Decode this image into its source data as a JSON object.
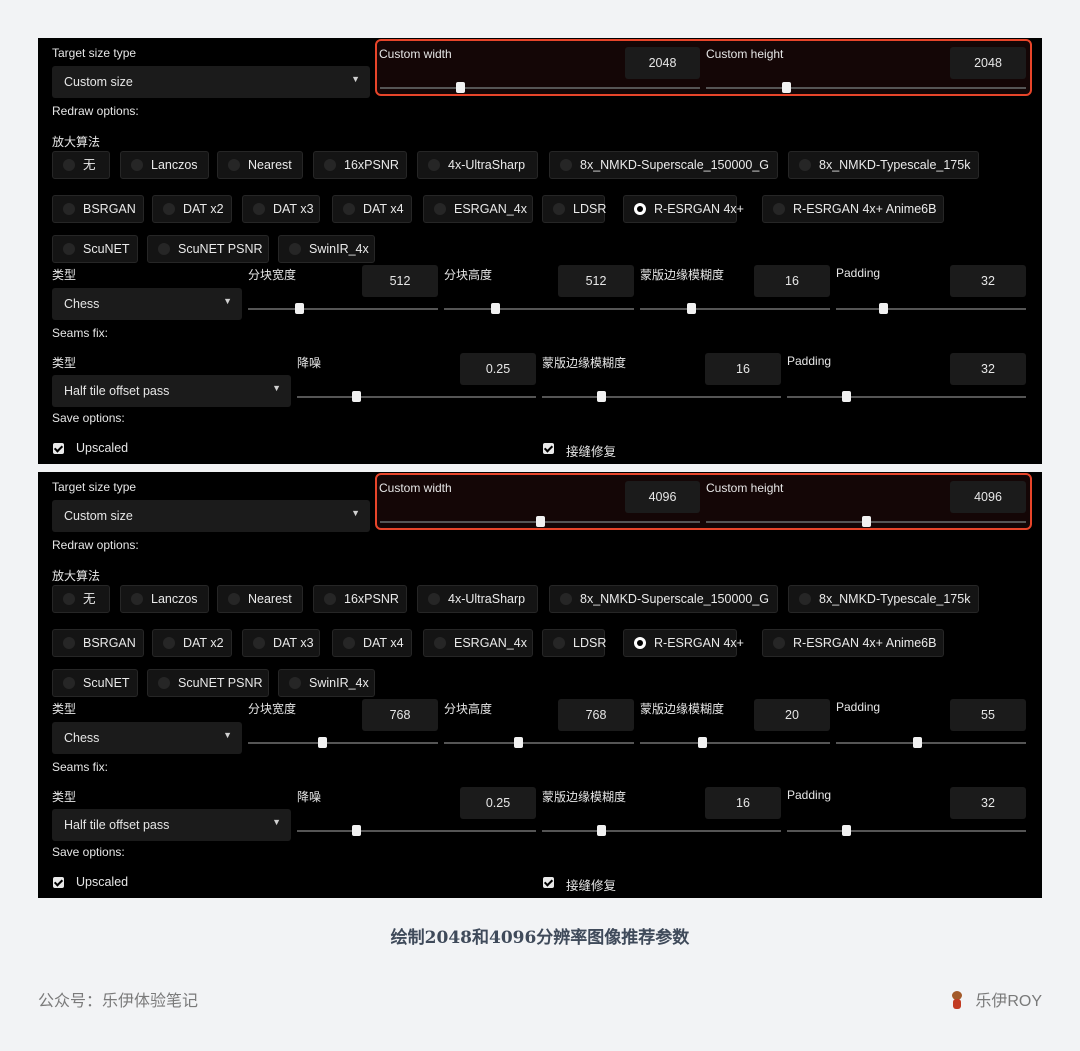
{
  "caption": "绘制2048和4096分辨率图像推荐参数",
  "footer": {
    "left": "公众号：乐伊体验笔记",
    "right": "乐伊ROY"
  },
  "panels": [
    {
      "target_size_type": {
        "label": "Target size type",
        "value": "Custom size"
      },
      "custom_width": {
        "label": "Custom width",
        "value": "2048",
        "slider": 0.25
      },
      "custom_height": {
        "label": "Custom height",
        "value": "2048",
        "slider": 0.25
      },
      "redraw_label": "Redraw options:",
      "upscaler_label": "放大算法",
      "upscalers": [
        "无",
        "Lanczos",
        "Nearest",
        "16xPSNR",
        "4x-UltraSharp",
        "8x_NMKD-Superscale_150000_G",
        "8x_NMKD-Typescale_175k",
        "BSRGAN",
        "DAT x2",
        "DAT x3",
        "DAT x4",
        "ESRGAN_4x",
        "LDSR",
        "R-ESRGAN 4x+",
        "R-ESRGAN 4x+ Anime6B",
        "ScuNET",
        "ScuNET PSNR",
        "SwinIR_4x"
      ],
      "selected_upscaler": "R-ESRGAN 4x+",
      "type": {
        "label": "类型",
        "value": "Chess"
      },
      "tile_width": {
        "label": "分块宽度",
        "value": "512",
        "slider": 0.27
      },
      "tile_height": {
        "label": "分块高度",
        "value": "512",
        "slider": 0.27
      },
      "mask_blur": {
        "label": "蒙版边缘模糊度",
        "value": "16",
        "slider": 0.27
      },
      "padding": {
        "label": "Padding",
        "value": "32",
        "slider": 0.25
      },
      "seams_label": "Seams fix:",
      "seams_type": {
        "label": "类型",
        "value": "Half tile offset pass"
      },
      "denoise": {
        "label": "降噪",
        "value": "0.25",
        "slider": 0.25
      },
      "seams_mask_blur": {
        "label": "蒙版边缘模糊度",
        "value": "16",
        "slider": 0.25
      },
      "seams_padding": {
        "label": "Padding",
        "value": "32",
        "slider": 0.25
      },
      "save_label": "Save options:",
      "save_upscaled": "Upscaled",
      "save_seams": "接缝修复"
    },
    {
      "target_size_type": {
        "label": "Target size type",
        "value": "Custom size"
      },
      "custom_width": {
        "label": "Custom width",
        "value": "4096",
        "slider": 0.5
      },
      "custom_height": {
        "label": "Custom height",
        "value": "4096",
        "slider": 0.5
      },
      "redraw_label": "Redraw options:",
      "upscaler_label": "放大算法",
      "upscalers": [
        "无",
        "Lanczos",
        "Nearest",
        "16xPSNR",
        "4x-UltraSharp",
        "8x_NMKD-Superscale_150000_G",
        "8x_NMKD-Typescale_175k",
        "BSRGAN",
        "DAT x2",
        "DAT x3",
        "DAT x4",
        "ESRGAN_4x",
        "LDSR",
        "R-ESRGAN 4x+",
        "R-ESRGAN 4x+ Anime6B",
        "ScuNET",
        "ScuNET PSNR",
        "SwinIR_4x"
      ],
      "selected_upscaler": "R-ESRGAN 4x+",
      "type": {
        "label": "类型",
        "value": "Chess"
      },
      "tile_width": {
        "label": "分块宽度",
        "value": "768",
        "slider": 0.39
      },
      "tile_height": {
        "label": "分块高度",
        "value": "768",
        "slider": 0.39
      },
      "mask_blur": {
        "label": "蒙版边缘模糊度",
        "value": "20",
        "slider": 0.33
      },
      "padding": {
        "label": "Padding",
        "value": "55",
        "slider": 0.43
      },
      "seams_label": "Seams fix:",
      "seams_type": {
        "label": "类型",
        "value": "Half tile offset pass"
      },
      "denoise": {
        "label": "降噪",
        "value": "0.25",
        "slider": 0.25
      },
      "seams_mask_blur": {
        "label": "蒙版边缘模糊度",
        "value": "16",
        "slider": 0.25
      },
      "seams_padding": {
        "label": "Padding",
        "value": "32",
        "slider": 0.25
      },
      "save_label": "Save options:",
      "save_upscaled": "Upscaled",
      "save_seams": "接缝修复"
    }
  ]
}
